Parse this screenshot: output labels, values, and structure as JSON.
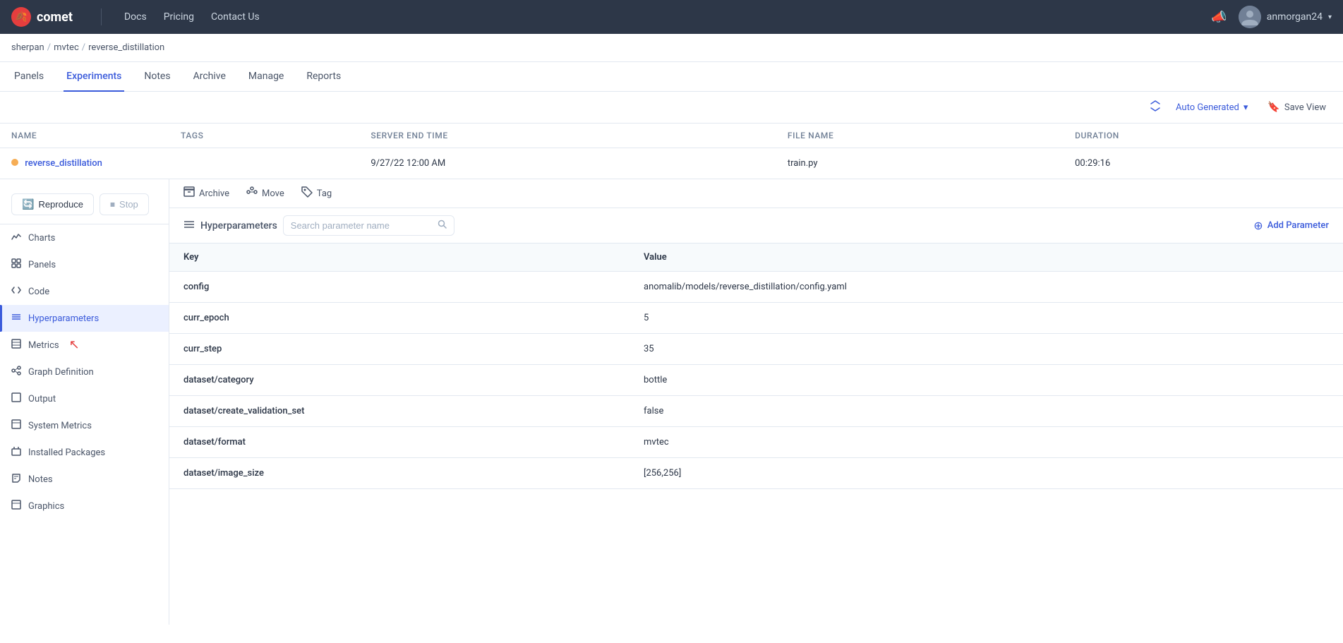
{
  "nav": {
    "logo_text": "comet",
    "links": [
      "Docs",
      "Pricing",
      "Contact Us"
    ],
    "user_name": "anmorgan24",
    "notification_icon": "🔔"
  },
  "breadcrumb": {
    "parts": [
      "sherpan",
      "mvtec",
      "reverse_distillation"
    ],
    "separators": [
      "/",
      "/"
    ]
  },
  "tabs": [
    {
      "label": "Panels",
      "active": false
    },
    {
      "label": "Experiments",
      "active": true
    },
    {
      "label": "Notes",
      "active": false
    },
    {
      "label": "Archive",
      "active": false
    },
    {
      "label": "Manage",
      "active": false
    },
    {
      "label": "Reports",
      "active": false
    }
  ],
  "view_controls": {
    "auto_generated": "Auto Generated",
    "save_view": "Save View",
    "chevron_down": "▾"
  },
  "experiment_table": {
    "columns": [
      "NAME",
      "TAGS",
      "SERVER END TIME",
      "FILE NAME",
      "DURATION"
    ],
    "row": {
      "name": "reverse_distillation",
      "tags": "",
      "server_end_time": "9/27/22 12:00 AM",
      "file_name": "train.py",
      "duration": "00:29:16"
    }
  },
  "sidebar_actions": {
    "reproduce": "Reproduce",
    "stop": "Stop"
  },
  "sidebar_nav": [
    {
      "id": "charts",
      "label": "Charts",
      "icon": "📈"
    },
    {
      "id": "panels",
      "label": "Panels",
      "icon": "⊞"
    },
    {
      "id": "code",
      "label": "Code",
      "icon": "⟨⟩"
    },
    {
      "id": "hyperparameters",
      "label": "Hyperparameters",
      "icon": "≡",
      "active": true
    },
    {
      "id": "metrics",
      "label": "Metrics",
      "icon": "⊟"
    },
    {
      "id": "graph-definition",
      "label": "Graph Definition",
      "icon": "✦"
    },
    {
      "id": "output",
      "label": "Output",
      "icon": "▭"
    },
    {
      "id": "system-metrics",
      "label": "System Metrics",
      "icon": "⊟"
    },
    {
      "id": "installed-packages",
      "label": "Installed Packages",
      "icon": "⊟"
    },
    {
      "id": "notes",
      "label": "Notes",
      "icon": "✏"
    },
    {
      "id": "graphics",
      "label": "Graphics",
      "icon": "⊟"
    }
  ],
  "content_actions": [
    {
      "id": "archive",
      "label": "Archive",
      "icon": "⊟"
    },
    {
      "id": "move",
      "label": "Move",
      "icon": "↔"
    },
    {
      "id": "tag",
      "label": "Tag",
      "icon": "🏷"
    }
  ],
  "hyperparameters": {
    "title": "Hyperparameters",
    "search_placeholder": "Search parameter name",
    "add_button": "Add Parameter",
    "columns": [
      "Key",
      "Value"
    ],
    "rows": [
      {
        "key": "config",
        "value": "anomalib/models/reverse_distillation/config.yaml"
      },
      {
        "key": "curr_epoch",
        "value": "5"
      },
      {
        "key": "curr_step",
        "value": "35"
      },
      {
        "key": "dataset/category",
        "value": "bottle"
      },
      {
        "key": "dataset/create_validation_set",
        "value": "false"
      },
      {
        "key": "dataset/format",
        "value": "mvtec"
      },
      {
        "key": "dataset/image_size",
        "value": "[256,256]"
      }
    ]
  }
}
